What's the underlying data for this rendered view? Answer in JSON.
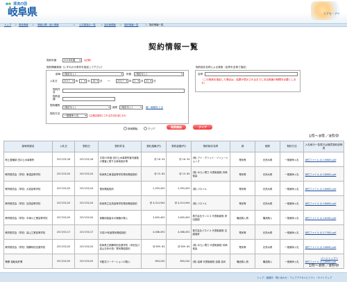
{
  "site": {
    "logo_small": "清流の国",
    "logo_big": "岐阜県",
    "mascot_text": "ミナモ・アイ"
  },
  "breadcrumb": [
    "トップ",
    "県政情報",
    "情報公開・個人情報",
    "公共調達の一覧",
    "会計管理局",
    "契約情報一覧",
    "契約情報一覧"
  ],
  "page_title": "契約情報一覧",
  "form": {
    "year_label": "契約年度",
    "year_value": "2018年度",
    "required": "(必須)",
    "cond_title": "契約情報検索（いずれかの条件を指定して下さい）",
    "dept_label": "部局",
    "dept_value": "(指定なし)",
    "div_label": "所属",
    "div_value": "(指定なし)",
    "date_label": "入札日",
    "date_from": {
      "y": "2017",
      "m": "1",
      "d": "16"
    },
    "date_to": {
      "y": "2017",
      "m": "1",
      "d": "22"
    },
    "y_unit": "年",
    "m_unit": "月",
    "d_unit": "日",
    "tilde": "～",
    "contract_name_label": "契約件名",
    "contract_amount_label": "契約金額",
    "category_label": "契約種別",
    "category_value": "(指定なし)",
    "detail_label": "細別",
    "detail_value": "(指定なし)",
    "clear_link": "細・細細をとる",
    "method_label": "契約方法",
    "method_value": "一般競争入札",
    "method_note": "(注)随意契約とされる方法を含むもの",
    "name_title": "契約相手名称による検索（名称を全角で指定）",
    "name_label": "名称",
    "name_note": "（この検索を指定した場合は、結果が表示されるまでにある程度の時間を必要とします）",
    "radio_open": "検索開始",
    "radio_clear": "クリア",
    "search_btn": "検索開始",
    "clear_btn": "クリア"
  },
  "count_text": "1件～8件／8件中",
  "columns": [
    "部局所属名",
    "入札日",
    "契約日",
    "契約件名",
    "落札価格(円)",
    "契約金額(円)",
    "契約相手名称",
    "部",
    "細別",
    "契約方法",
    "入札執行一覧表又は随意契約説明書"
  ],
  "rows": [
    [
      "県土整備部 田口土木事務所",
      "2017/01/18",
      "2017/01/18",
      "平成29年度 田口土木事務所管内道路の雪害に関する事後設計等",
      "@ 16. 94",
      "@ 16. 94",
      "(株) アイ・グリッド・ソリューションズ",
      "電気等",
      "光熱水費",
      "一般競争入札",
      "添付ファイル (0.198KB).pdf"
    ],
    [
      "教育委員会（学校）東濃高等学校",
      "2017/01/20",
      "2017/01/24",
      "岐阜県立東濃高等学校電気需給契約",
      "@ 15. 84",
      "@ 15. 84",
      "(株) みらい電力 代表取締役 河崎儀喜",
      "電気等",
      "光熱水費",
      "一般競争入札",
      "添付ファイル (0.188KB).pdf"
    ],
    [
      "教育委員会（学校）大垣高等学校",
      "2017/01/20",
      "2017/01/24",
      "電気需給契約",
      "2,993,450",
      "2,993,450",
      "(株) パネイル",
      "電気等",
      "光熱水費",
      "一般競争入札",
      "添付ファイル (0.188KB).pdf"
    ],
    [
      "教育委員会（学校）加茂高等学校",
      "2017/01/20",
      "2017/01/24",
      "岐阜県立加茂高等学校電気需給契約",
      "@ 4,014,944",
      "@ 4,014,944",
      "(株) パネイル",
      "電気等",
      "光熱水費",
      "一般競争入札",
      "添付ファイル (0.188KB).pdf"
    ],
    [
      "教育委員会（学校）中津川工業高等学校",
      "2017/01/20",
      "2017/01/20",
      "実験用旋盤ほか機器の購入",
      "3,650,400",
      "3,650,400",
      "株式会社サンエス 代表取締役 岸田昌樹",
      "備品購入費",
      "備品購入",
      "一般競争入札",
      "添付ファイル (0.182KB).pdf"
    ],
    [
      "教育委員会（学校）高山工業高等学校",
      "2017/01/17",
      "2017/01/17",
      "平成29年度電気需給契約",
      "4,088,492",
      "4,088,492",
      "株式会社パネイル 代表取締役 名越達彦",
      "電気等",
      "光熱水費",
      "一般競争入札",
      "添付ファイル (0.177KB).pdf"
    ],
    [
      "教育委員会（学校）飛騨特別支援学校",
      "2017/01/20",
      "2017/01/24",
      "岐阜県立飛騨特別支援学校（本校及び高山日赤分校）電気需給契約",
      "@ 859. 84",
      "@ 859. 84",
      "(株) みらい電力 代表取締役 河崎儀喜",
      "電気等",
      "光熱水費",
      "一般競争入札",
      "添付ファイル (0.188KB).pdf"
    ],
    [
      "警察 運転免許課",
      "2017/01/20",
      "2017/01/25",
      "可動式パーテーションの購入",
      "894,240",
      "894,240",
      "(株) 高碕 代表取締役 高橋 浩司",
      "備品購入費",
      "備品購入",
      "一般競争入札",
      "添付ファイル (0.188KB).pdf"
    ]
  ],
  "page_top": "ページトップへ",
  "footer": {
    "links": "トップ｜連絡先・問い合わせ｜ウェブアクセシビリティ｜サイトマップ"
  }
}
